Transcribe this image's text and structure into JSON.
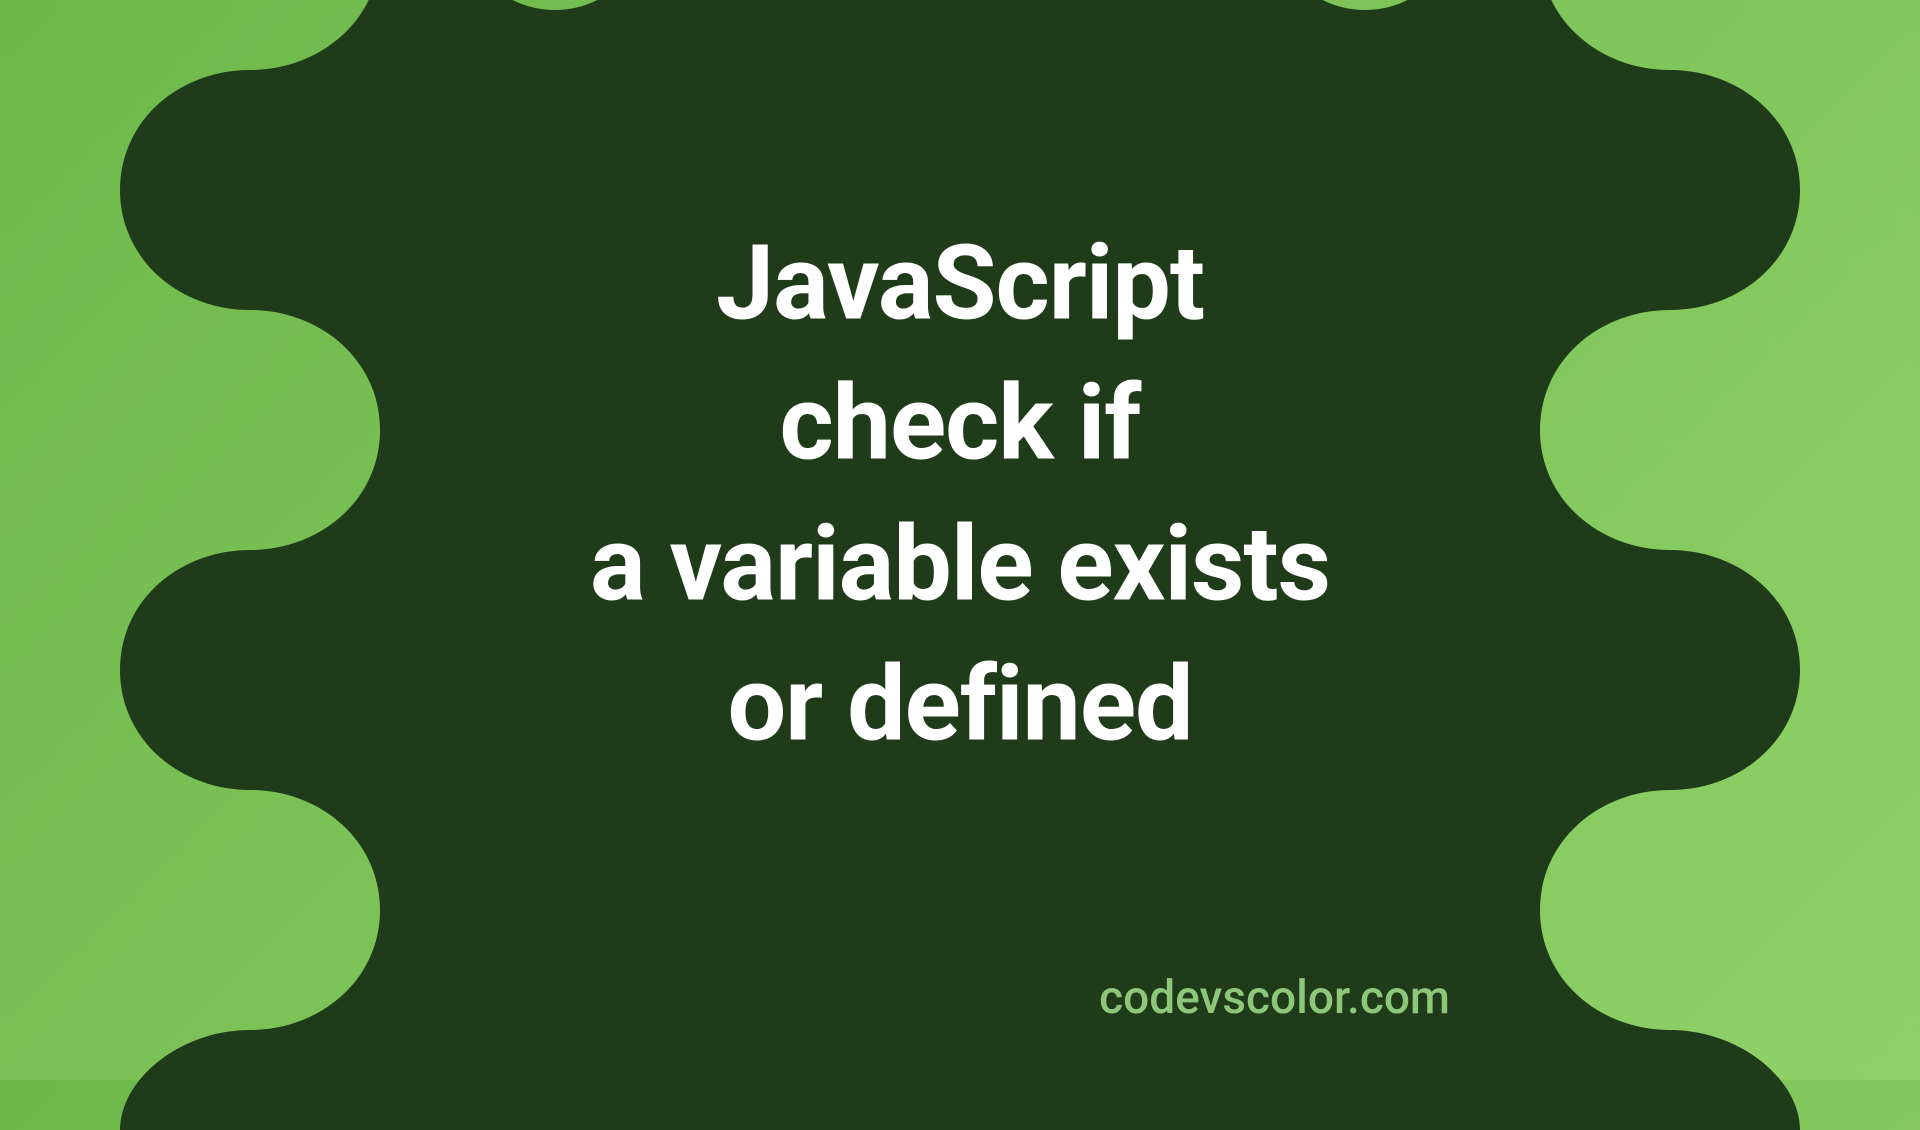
{
  "title": {
    "line1": "JavaScript",
    "line2": "check if",
    "line3": "a variable exists",
    "line4": "or defined"
  },
  "watermark": "codevscolor.com",
  "colors": {
    "background_gradient_start": "#6eb84a",
    "background_gradient_end": "#8fd168",
    "blob": "#1f3b1a",
    "title_text": "#ffffff",
    "watermark_text": "#8fc77a"
  }
}
